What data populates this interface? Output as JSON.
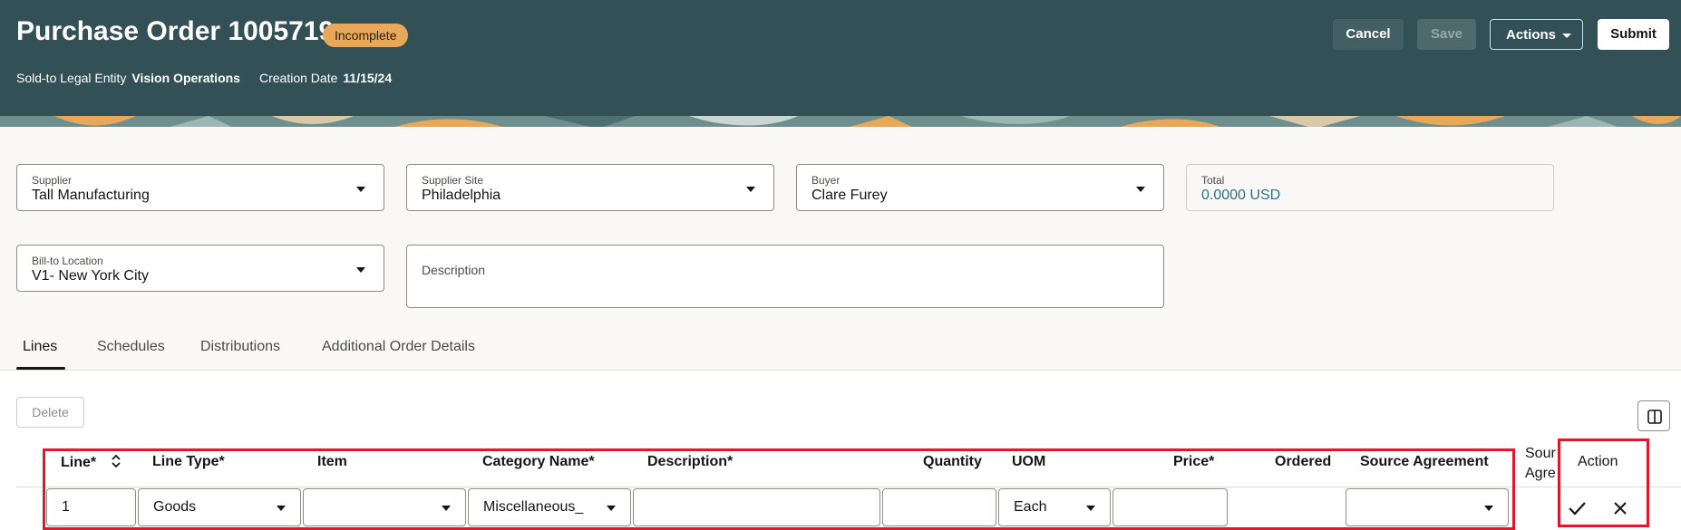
{
  "header": {
    "title": "Purchase Order 1005719",
    "status": "Incomplete",
    "sold_to_label": "Sold-to Legal Entity",
    "sold_to_value": "Vision Operations",
    "creation_label": "Creation Date",
    "creation_value": "11/15/24",
    "buttons": {
      "cancel": "Cancel",
      "save": "Save",
      "actions": "Actions",
      "submit": "Submit"
    }
  },
  "form": {
    "supplier": {
      "label": "Supplier",
      "value": "Tall Manufacturing"
    },
    "supplier_site": {
      "label": "Supplier Site",
      "value": "Philadelphia"
    },
    "buyer": {
      "label": "Buyer",
      "value": "Clare Furey"
    },
    "total": {
      "label": "Total",
      "value": "0.0000 USD"
    },
    "bill_to": {
      "label": "Bill-to Location",
      "value": "V1- New York City"
    },
    "description": {
      "label": "Description",
      "value": ""
    }
  },
  "tabs": [
    "Lines",
    "Schedules",
    "Distributions",
    "Additional Order Details"
  ],
  "lines": {
    "delete_label": "Delete",
    "columns": {
      "line": "Line*",
      "line_type": "Line Type*",
      "item": "Item",
      "category": "Category Name*",
      "description": "Description*",
      "quantity": "Quantity",
      "uom": "UOM",
      "price": "Price*",
      "ordered": "Ordered",
      "source_agreement": "Source Agreement",
      "source_line_a": "Sour",
      "source_line_b": "Agre",
      "action": "Action"
    },
    "row": {
      "line": "1",
      "line_type": "Goods",
      "item": "",
      "category": "Miscellaneous_",
      "description": "",
      "quantity": "",
      "uom": "Each",
      "price": "",
      "source_agreement": ""
    }
  },
  "colors": {
    "header_bg": "#325055",
    "badge": "#e8a85a",
    "highlight": "#e0182d",
    "total_value": "#2f6f86"
  }
}
